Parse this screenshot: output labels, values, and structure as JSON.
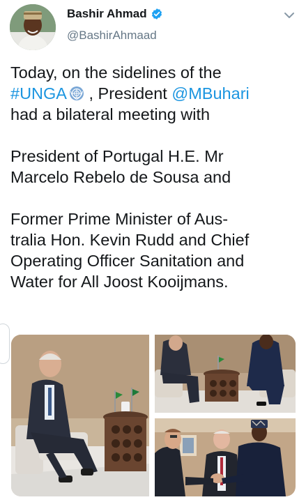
{
  "author": {
    "name": "Bashir Ahmad",
    "handle": "@BashirAhmaad",
    "verified": true,
    "avatar_icon": "profile-photo"
  },
  "tweet": {
    "line1": "Today, on the sidelines of the",
    "hashtag": "#UNGA",
    "after_hashtag": " , President ",
    "mention": "@MBuhari",
    "line3": "had a bilateral meeting with",
    "para2_line1": "President of Portugal H.E. Mr",
    "para2_line2": "Marcelo Rebelo de Sousa and",
    "para3_line1": "Former Prime Minister of Aus-",
    "para3_line2": "tralia Hon. Kevin Rudd and Chief",
    "para3_line3": "Operating Officer Sanitation and",
    "para3_line4": "Water for All Joost Kooijmans."
  },
  "icons": {
    "verified": "verified-badge-icon",
    "menu": "chevron-down-icon",
    "un": "un-emblem-icon"
  },
  "colors": {
    "link": "#1b95e0",
    "verified": "#1da1f2",
    "text": "#14171a",
    "muted": "#657786"
  },
  "media": {
    "count": 3
  }
}
